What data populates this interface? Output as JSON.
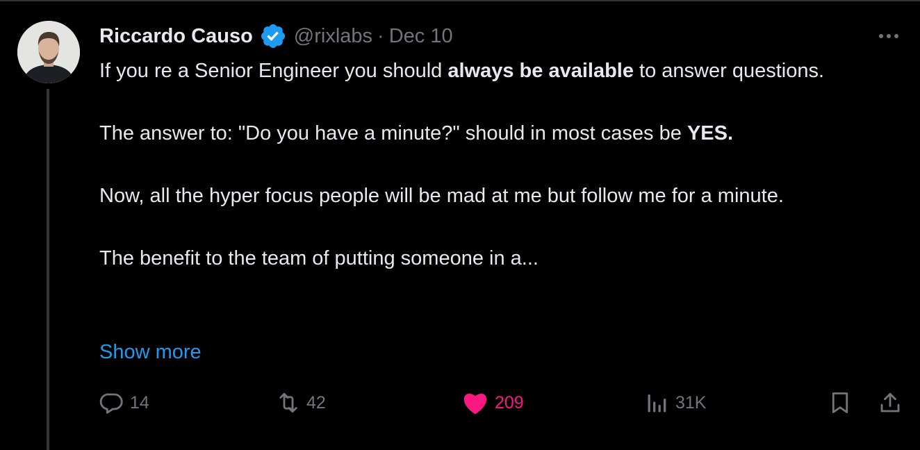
{
  "tweet": {
    "author": {
      "name": "Riccardo Causo",
      "handle": "@rixlabs",
      "verified": true
    },
    "separator": "·",
    "date": "Dec 10",
    "more_icon": "more-horizontal-icon",
    "text": {
      "p1_before": "If you re a Senior Engineer you should ",
      "p1_bold": "always be available",
      "p1_after": " to answer questions.",
      "p2_before": "The answer to: \"Do you have a minute?\" should in most cases be ",
      "p2_bold": "YES.",
      "p3": "Now, all the hyper focus people will be mad at me but follow me for a minute.",
      "p4": "The benefit to the team of putting someone in a..."
    },
    "show_more": "Show more",
    "actions": {
      "reply": {
        "icon": "reply-icon",
        "count": "14"
      },
      "retweet": {
        "icon": "retweet-icon",
        "count": "42"
      },
      "like": {
        "icon": "heart-icon",
        "count": "209",
        "liked": true
      },
      "views": {
        "icon": "views-icon",
        "count": "31K"
      },
      "bookmark": {
        "icon": "bookmark-icon"
      },
      "share": {
        "icon": "share-icon"
      }
    }
  },
  "colors": {
    "background": "#000000",
    "text": "#e7e9ea",
    "muted": "#71767b",
    "link": "#1d9bf0",
    "like": "#f91880",
    "verified": "#1d9bf0"
  }
}
